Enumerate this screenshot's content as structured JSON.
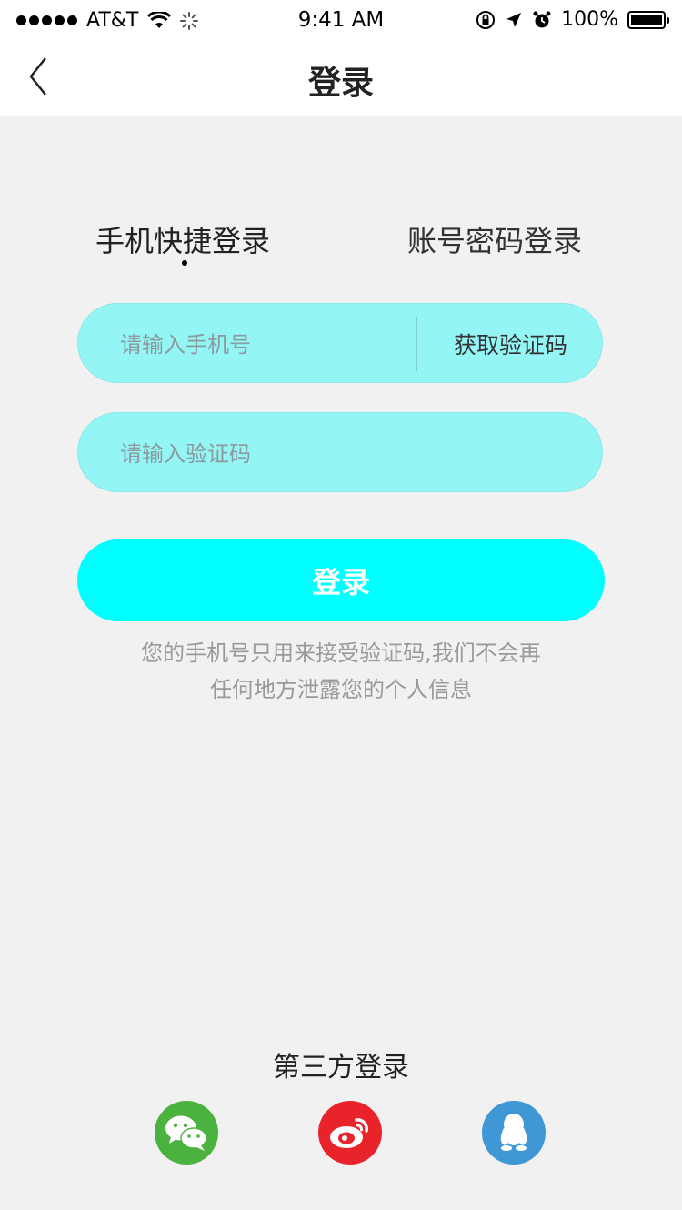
{
  "status_bar": {
    "carrier": "AT&T",
    "time": "9:41 AM",
    "battery": "100%"
  },
  "nav": {
    "title": "登录",
    "back_icon": "chevron-left-icon"
  },
  "tabs": [
    {
      "label": "手机快捷登录",
      "selected": true
    },
    {
      "label": "账号密码登录",
      "selected": false
    }
  ],
  "phone_field": {
    "value": "",
    "placeholder": "请输入手机号",
    "action_label": "获取验证码"
  },
  "code_field": {
    "value": "",
    "placeholder": "请输入验证码"
  },
  "login_button": {
    "label": "登录"
  },
  "notice": {
    "line1": "您的手机号只用来接受验证码,我们不会再",
    "line2": "任何地方泄露您的个人信息"
  },
  "third_party": {
    "title": "第三方登录",
    "providers": [
      {
        "icon": "wechat-icon",
        "color": "#4cb23f"
      },
      {
        "icon": "weibo-icon",
        "color": "#e8232a"
      },
      {
        "icon": "qq-icon",
        "color": "#3f97d6"
      }
    ]
  },
  "colors": {
    "field_bg": "#94f5f5",
    "button_bg": "#00ffff",
    "page_bg": "#f1f1f1",
    "notice_text": "#999999"
  }
}
